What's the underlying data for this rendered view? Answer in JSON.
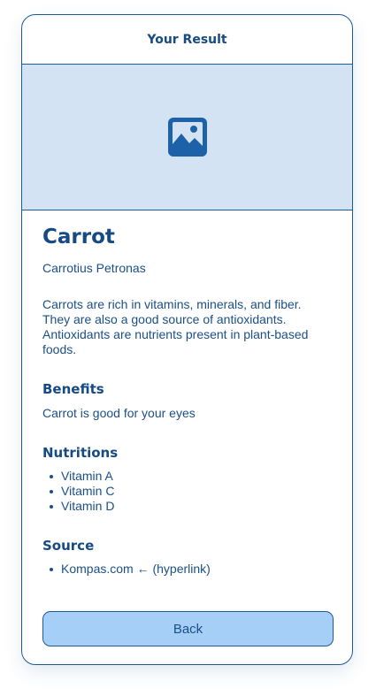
{
  "header": {
    "title": "Your Result"
  },
  "image": {
    "icon": "image-icon",
    "background_color": "#d3e3f4",
    "icon_color": "#1d62a8"
  },
  "plant": {
    "name": "Carrot",
    "latin_name": "Carrotius Petronas",
    "description": "Carrots are rich in vitamins, minerals, and fiber. They are also a good source of antioxidants. Antioxidants are nutrients present in plant-based foods."
  },
  "benefits": {
    "title": "Benefits",
    "text": "Carrot is good for your eyes"
  },
  "nutritions": {
    "title": "Nutritions",
    "items": [
      "Vitamin A",
      "Vitamin C",
      "Vitamin D"
    ]
  },
  "source": {
    "title": "Source",
    "items": [
      "Kompas.com ← (hyperlink)"
    ]
  },
  "actions": {
    "back_label": "Back"
  },
  "colors": {
    "primary": "#1b4f86",
    "border": "#1d5a99",
    "button_bg": "#a6cff8"
  }
}
